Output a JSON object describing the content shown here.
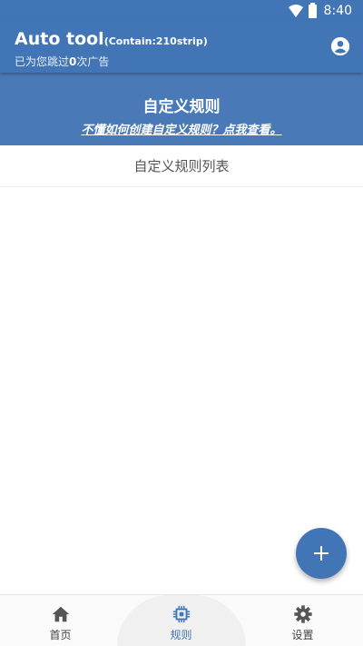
{
  "status_bar": {
    "time": "8:40"
  },
  "app_bar": {
    "title_main": "Auto tool",
    "title_sub": "(Contain:210strip)",
    "skip_prefix": "已为您跳过",
    "skip_count": "0",
    "skip_suffix": "次广告",
    "account_icon": "account-circle-icon"
  },
  "banner": {
    "title": "自定义规则",
    "help_link": "不懂如何创建自定义规则？点我查看。"
  },
  "list": {
    "header": "自定义规则列表"
  },
  "fab": {
    "icon": "plus-icon"
  },
  "bottom_nav": {
    "items": [
      {
        "label": "首页",
        "icon": "home-icon"
      },
      {
        "label": "规则",
        "icon": "chip-icon",
        "active": true
      },
      {
        "label": "设置",
        "icon": "gear-icon"
      }
    ]
  },
  "colors": {
    "primary": "#4275b5",
    "banner": "#4a79b8"
  }
}
